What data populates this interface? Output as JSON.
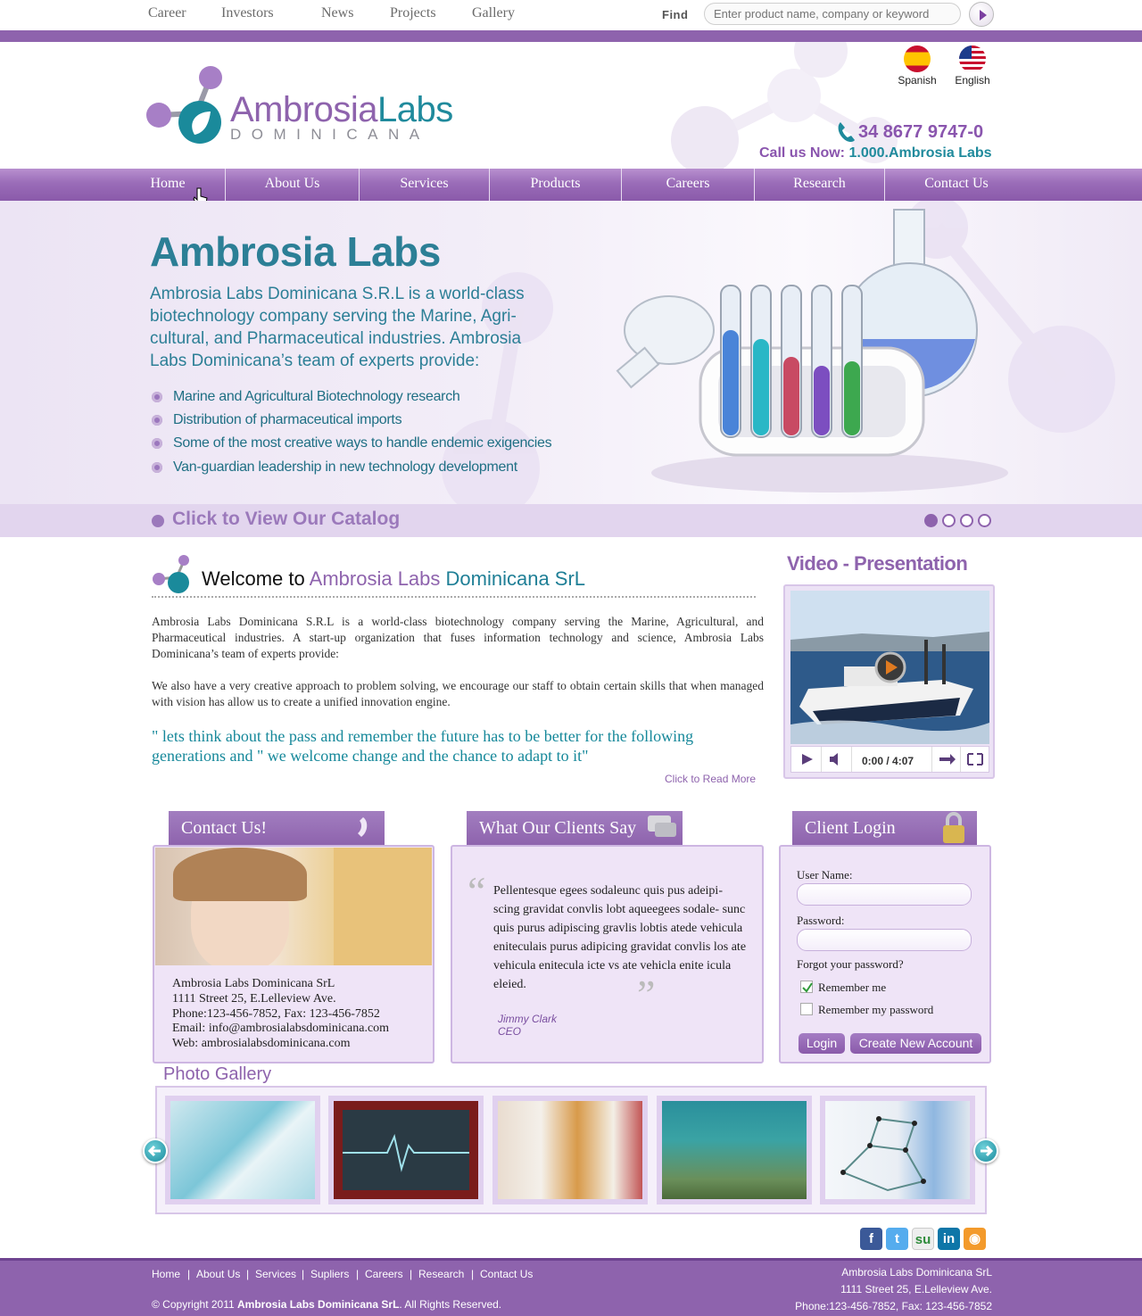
{
  "topnav": {
    "links": [
      "Career",
      "Investors",
      "News",
      "Projects",
      "Gallery"
    ],
    "find_label": "Find",
    "search_placeholder": "Enter product name, company or keyword"
  },
  "header": {
    "logo_main_a": "Ambrosia",
    "logo_main_b": "Labs",
    "logo_sub": "DOMINICANA",
    "languages": [
      "Spanish",
      "English"
    ],
    "phone": "34 8677 9747-0",
    "call_label": "Call us Now:",
    "call_value": "1.000.Ambrosia Labs"
  },
  "nav": {
    "items": [
      "Home",
      "About Us",
      "Services",
      "Products",
      "Careers",
      "Research",
      "Contact Us"
    ],
    "active": "Home"
  },
  "hero": {
    "title": "Ambrosia Labs",
    "description": "Ambrosia Labs Dominicana S.R.L is a world-class biotechnology company serving the Marine, Agri- cultural, and Pharmaceutical industries. Ambrosia Labs Dominicana’s team of experts provide:",
    "bullets": [
      "Marine and Agricultural Biotechnology research",
      "Distribution of pharmaceutical imports",
      "Some of the most creative ways to handle endemic exigencies",
      "Van-guardian leadership in new technology development"
    ],
    "catalog_link": "Click to View Our Catalog",
    "slides_total": 4,
    "slide_active": 1
  },
  "welcome": {
    "title_prefix": "Welcome to",
    "title_brand_a": "Ambrosia Labs",
    "title_brand_b": "Dominicana SrL",
    "para1": "Ambrosia Labs Dominicana S.R.L is a world-class biotechnology company serving the Marine, Agricultural, and Pharmaceutical industries. A start-up organization that fuses information technology and science, Ambrosia Labs Dominicana’s team of experts provide:",
    "para2": "We also have a very creative approach to problem solving, we encourage our staff to obtain certain skills that when managed with vision has allow us to create a unified innovation engine.",
    "quote": "\" lets think about the pass and remember the future has to be better for the following generations and \" we welcome change and the chance to adapt to it\"",
    "read_more": "Click to Read More"
  },
  "video": {
    "title": "Video - Presentation",
    "time": "0:00 / 4:07"
  },
  "contact": {
    "title": "Contact Us!",
    "lines": [
      "Ambrosia Labs Dominicana SrL",
      "1111 Street 25, E.Lelleview Ave.",
      "Phone:123-456-7852,  Fax: 123-456-7852",
      "Email:  info@ambrosialabsdominicana.com",
      "Web:  ambrosialabsdominicana.com"
    ]
  },
  "clients": {
    "title": "What Our Clients Say",
    "testimonial": "Pellentesque egees sodaleunc quis pus adeipi- scing gravidat convlis lobt aqueegees sodale- sunc quis purus adipiscing gravlis lobtis atede vehicula eniteculais purus adipicing gravidat convlis los ate vehicula enitecula icte vs ate vehicla enite icula eleied.",
    "author_name": "Jimmy Clark",
    "author_role": "CEO"
  },
  "login": {
    "title": "Client Login",
    "username_label": "User Name:",
    "password_label": "Password:",
    "forgot": "Forgot your password?",
    "remember_me": "Remember me",
    "remember_me_checked": true,
    "remember_password": "Remember my password",
    "remember_password_checked": false,
    "login_button": "Login",
    "create_button": "Create New Account"
  },
  "gallery": {
    "title": "Photo Gallery",
    "photos": [
      "pipette-icon",
      "heart-monitor-icon",
      "medicine-bottles-icon",
      "diver-icon",
      "molecule-model-icon"
    ]
  },
  "social": [
    "facebook-icon",
    "twitter-icon",
    "stumbleupon-icon",
    "linkedin-icon",
    "rss-icon"
  ],
  "footer": {
    "links": [
      "Home",
      "About Us",
      "Services",
      "Supliers",
      "Careers",
      "Research",
      "Contact Us"
    ],
    "copyright_pre": "© Copyright 2011",
    "copyright_brand": "Ambrosia Labs Dominicana SrL",
    "copyright_post": ". All Rights Reserved.",
    "address_lines": [
      "Ambrosia Labs Dominicana SrL",
      "1111 Street 25, E.Lelleview Ave.",
      "Phone:123-456-7852,  Fax: 123-456-7852"
    ]
  },
  "colors": {
    "brand_purple": "#8e63ad",
    "brand_teal": "#2c7f96"
  }
}
